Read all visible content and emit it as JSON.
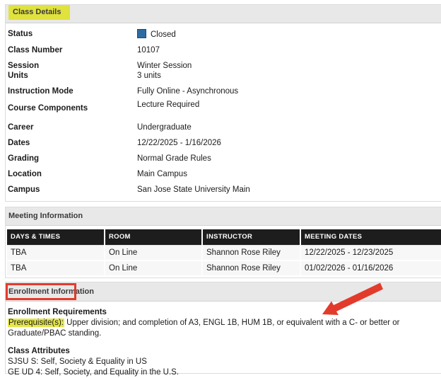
{
  "colors": {
    "highlight_yellow": "#e0e23e",
    "annotation_red": "#e23b2c",
    "status_blue": "#2d6ca2",
    "table_header_bg": "#1d1d1d",
    "section_bar_bg": "#e8e8e8"
  },
  "class_details": {
    "title": "Class Details",
    "fields": [
      {
        "label": "Status",
        "value": "Closed",
        "icon": "closed-status-square-icon"
      },
      {
        "label": "Class Number",
        "value": "10107"
      },
      {
        "label": "Session",
        "value": "Winter Session"
      },
      {
        "label": "Units",
        "value": "3 units"
      },
      {
        "label": "Instruction Mode",
        "value": "Fully Online - Asynchronous"
      },
      {
        "label": "Course Components",
        "value": "Lecture Required"
      },
      {
        "label": "Career",
        "value": "Undergraduate"
      },
      {
        "label": "Dates",
        "value": "12/22/2025 - 1/16/2026"
      },
      {
        "label": "Grading",
        "value": "Normal Grade Rules"
      },
      {
        "label": "Location",
        "value": "Main Campus"
      },
      {
        "label": "Campus",
        "value": "San Jose State University Main"
      }
    ]
  },
  "meeting": {
    "title": "Meeting Information",
    "columns": [
      "DAYS & TIMES",
      "ROOM",
      "INSTRUCTOR",
      "MEETING DATES"
    ],
    "rows": [
      [
        "TBA",
        "On Line",
        "Shannon Rose Riley",
        "12/22/2025 - 12/23/2025"
      ],
      [
        "TBA",
        "On Line",
        "Shannon Rose Riley",
        "01/02/2026 - 01/16/2026"
      ]
    ]
  },
  "enrollment": {
    "title": "Enrollment Information",
    "requirements_heading": "Enrollment Requirements",
    "prerequisite_label": "Prerequisite(s):",
    "prerequisite_text": "Upper division; and completion of A3, ENGL 1B, HUM 1B, or equivalent with a C- or better or Graduate/PBAC standing.",
    "attributes_heading": "Class Attributes",
    "attributes": [
      "SJSU S: Self, Society & Equality in US",
      "GE UD 4: Self, Society, and Equality in the U.S."
    ]
  }
}
